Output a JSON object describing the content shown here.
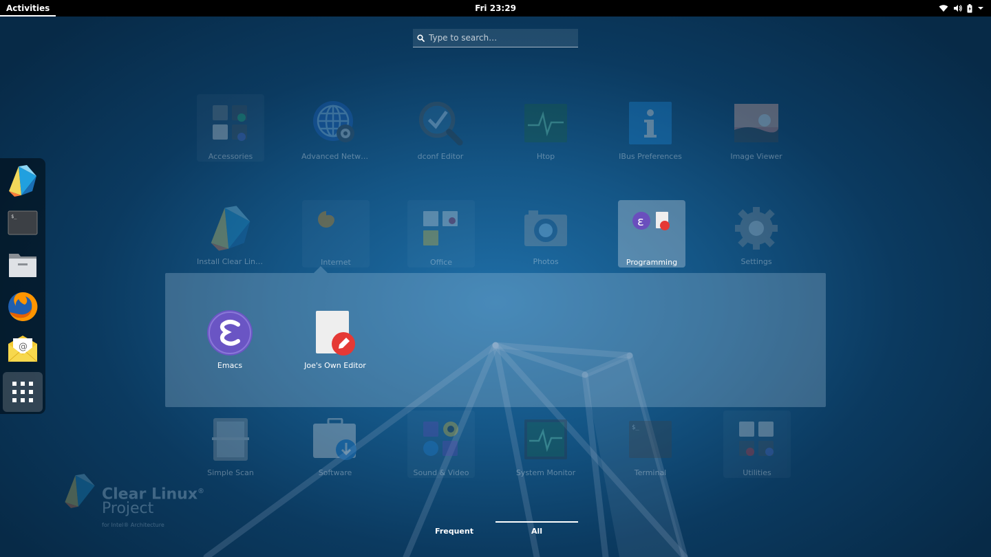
{
  "topbar": {
    "activities_label": "Activities",
    "clock": "Fri 23:29",
    "tray_icons": [
      "wifi-icon",
      "volume-icon",
      "battery-icon",
      "chevron-down-icon"
    ]
  },
  "search": {
    "placeholder": "Type to search…"
  },
  "dash": {
    "items": [
      {
        "name": "clear-linux-installer",
        "icon": "clear-linux-icon"
      },
      {
        "name": "terminal",
        "icon": "terminal-icon"
      },
      {
        "name": "files",
        "icon": "folder-icon"
      },
      {
        "name": "firefox",
        "icon": "firefox-icon"
      },
      {
        "name": "mail",
        "icon": "mail-icon"
      },
      {
        "name": "show-applications",
        "icon": "app-grid-icon"
      }
    ]
  },
  "apps": {
    "row1": [
      {
        "label": "Accessories",
        "icon": "folder-accessories-icon"
      },
      {
        "label": "Advanced Netwo…",
        "icon": "network-globe-icon"
      },
      {
        "label": "dconf Editor",
        "icon": "dconf-magnifier-icon"
      },
      {
        "label": "Htop",
        "icon": "htop-icon"
      },
      {
        "label": "IBus Preferences",
        "icon": "info-icon"
      },
      {
        "label": "Image Viewer",
        "icon": "image-icon"
      }
    ],
    "row2": [
      {
        "label": "Install Clear Linu…",
        "icon": "clear-linux-icon"
      },
      {
        "label": "Internet",
        "icon": "folder-internet-icon"
      },
      {
        "label": "Office",
        "icon": "folder-office-icon"
      },
      {
        "label": "Photos",
        "icon": "camera-icon"
      },
      {
        "label": "Programming",
        "icon": "folder-programming-icon"
      },
      {
        "label": "Settings",
        "icon": "gear-icon"
      }
    ],
    "row3": [
      {
        "label": "Simple Scan",
        "icon": "scanner-icon"
      },
      {
        "label": "Software",
        "icon": "software-bag-icon"
      },
      {
        "label": "Sound & Video",
        "icon": "folder-sound-video-icon"
      },
      {
        "label": "System Monitor",
        "icon": "system-monitor-icon"
      },
      {
        "label": "Terminal",
        "icon": "terminal-icon"
      },
      {
        "label": "Utilities",
        "icon": "folder-utilities-icon"
      }
    ]
  },
  "folder_popup": {
    "apps": [
      {
        "label": "Emacs",
        "icon": "emacs-icon"
      },
      {
        "label": "Joe's Own Editor",
        "icon": "text-editor-icon"
      }
    ]
  },
  "logo": {
    "name": "Clear Linux",
    "registered": "®",
    "sub": "Project",
    "tiny": "for Intel® Architecture"
  },
  "view_switch": {
    "frequent": "Frequent",
    "all": "All"
  }
}
